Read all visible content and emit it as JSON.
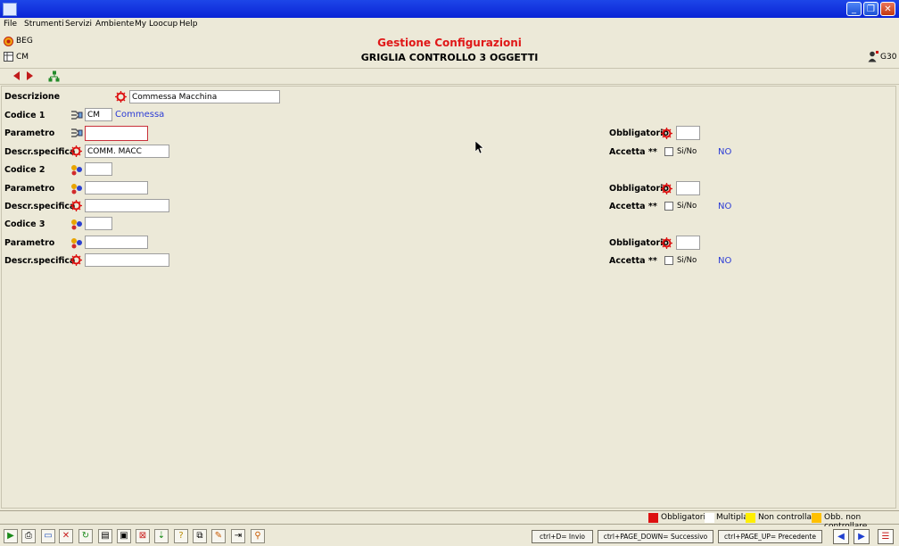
{
  "window": {
    "title": "",
    "min_label": "_",
    "restore_label": "❐",
    "close_label": "✕"
  },
  "menu": [
    "File",
    "Strumenti",
    "Servizi",
    "Ambiente",
    "My Loocup",
    "Help"
  ],
  "header": {
    "left_top": "BEG",
    "left_bottom": "CM",
    "title": "Gestione Configurazioni",
    "subtitle": "GRIGLIA CONTROLLO 3 OGGETTI",
    "right_code": "G30"
  },
  "colors": {
    "title_red": "#e01818",
    "link_blue": "#2b3bd6",
    "req_red": "#dd1111",
    "yellow": "#ffef00",
    "orange": "#ffc000"
  },
  "form": {
    "descrizione": {
      "label": "Descrizione",
      "value": "Commessa Macchina"
    },
    "codice1": {
      "label": "Codice 1",
      "value": "CM",
      "desc": "Commessa"
    },
    "parametro1": {
      "label": "Parametro",
      "value": ""
    },
    "descr1": {
      "label": "Descr.specifica",
      "value": "COMM. MACC"
    },
    "codice2": {
      "label": "Codice 2",
      "value": ""
    },
    "parametro2": {
      "label": "Parametro",
      "value": ""
    },
    "descr2": {
      "label": "Descr.specifica",
      "value": ""
    },
    "codice3": {
      "label": "Codice 3",
      "value": ""
    },
    "parametro3": {
      "label": "Parametro",
      "value": ""
    },
    "descr3": {
      "label": "Descr.specifica",
      "value": ""
    },
    "obbligatorio": {
      "label": "Obbligatorio"
    },
    "accetta": {
      "label": "Accetta **",
      "checkbox_label": "Si/No"
    },
    "accetta_values": [
      "NO",
      "NO",
      "NO"
    ]
  },
  "legend": [
    {
      "label": "Obbligatoria",
      "color": "#dd1111"
    },
    {
      "label": "Multipla",
      "color": "#ffffff"
    },
    {
      "label": "Non controllare",
      "color": "#ffef00"
    },
    {
      "label": "Obb. non controllare",
      "color": "#ffc000"
    }
  ],
  "shortcuts": {
    "invio": "ctrl+D= Invio",
    "successivo": "ctrl+PAGE_DOWN= Successivo",
    "precedente": "ctrl+PAGE_UP= Precedente"
  }
}
